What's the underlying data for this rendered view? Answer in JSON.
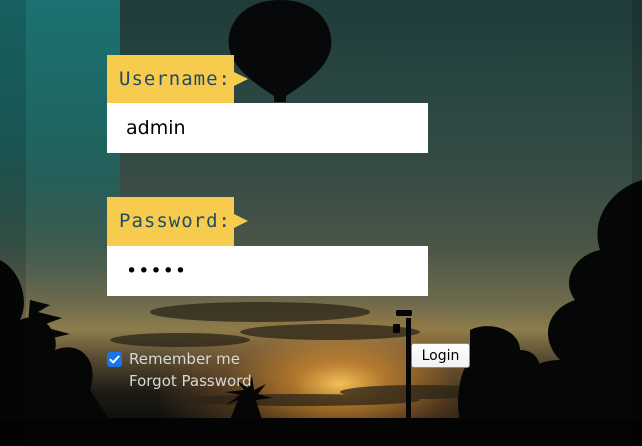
{
  "form": {
    "username_label": "Username:",
    "username_value": "admin",
    "password_label": "Password:",
    "password_value": "•••••",
    "remember_label": "Remember me",
    "remember_checked": true,
    "forgot_label": "Forgot Password",
    "login_label": "Login"
  },
  "colors": {
    "label_background": "#f7cb4d",
    "label_text": "#1e4c69",
    "checkbox_accent": "#1a73e8"
  },
  "background": {
    "description_icons": [
      "hot-air-balloon-silhouette",
      "palm-tree-silhouettes",
      "street-lamp-silhouette",
      "sunset-sky"
    ]
  }
}
